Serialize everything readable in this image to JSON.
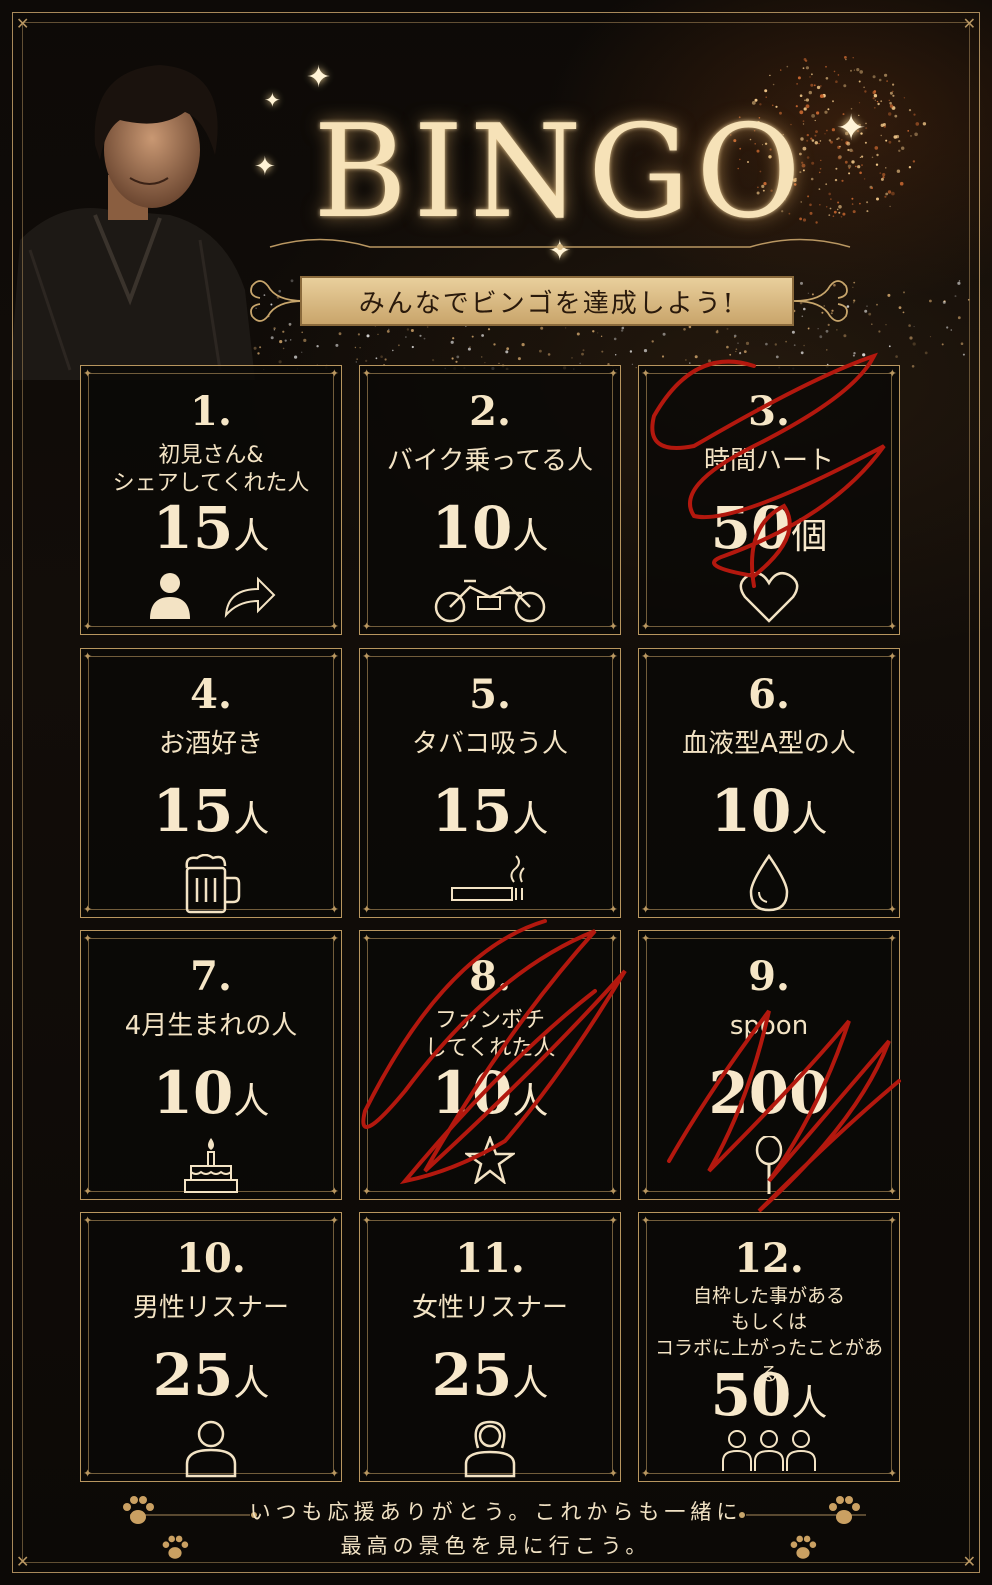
{
  "header": {
    "title": "BINGO",
    "subtitle": "みんなでビンゴを達成しよう!"
  },
  "cells": [
    {
      "number": "1.",
      "label_lines": [
        "初見さん&",
        "シェアしてくれた人"
      ],
      "goal": "15",
      "unit": "人",
      "icon": "user-share-icon",
      "crossed": false
    },
    {
      "number": "2.",
      "label_lines": [
        "バイク乗ってる人"
      ],
      "goal": "10",
      "unit": "人",
      "icon": "motorcycle-icon",
      "crossed": false
    },
    {
      "number": "3.",
      "label_lines": [
        "時間ハート"
      ],
      "goal": "50",
      "unit": "個",
      "icon": "heart-icon",
      "crossed": true
    },
    {
      "number": "4.",
      "label_lines": [
        "お酒好き"
      ],
      "goal": "15",
      "unit": "人",
      "icon": "beer-mug-icon",
      "crossed": false
    },
    {
      "number": "5.",
      "label_lines": [
        "タバコ吸う人"
      ],
      "goal": "15",
      "unit": "人",
      "icon": "cigarette-icon",
      "crossed": false
    },
    {
      "number": "6.",
      "label_lines": [
        "血液型A型の人"
      ],
      "goal": "10",
      "unit": "人",
      "icon": "blood-drop-icon",
      "crossed": false
    },
    {
      "number": "7.",
      "label_lines": [
        "4月生まれの人"
      ],
      "goal": "10",
      "unit": "人",
      "icon": "birthday-cake-icon",
      "crossed": false
    },
    {
      "number": "8.",
      "label_lines": [
        "ファンボチ",
        "してくれた人"
      ],
      "goal": "10",
      "unit": "人",
      "icon": "star-icon",
      "crossed": true
    },
    {
      "number": "9.",
      "label_lines": [
        "spoon"
      ],
      "goal": "200",
      "unit": "",
      "icon": "spoon-icon",
      "crossed": true
    },
    {
      "number": "10.",
      "label_lines": [
        "男性リスナー"
      ],
      "goal": "25",
      "unit": "人",
      "icon": "male-user-icon",
      "crossed": false
    },
    {
      "number": "11.",
      "label_lines": [
        "女性リスナー"
      ],
      "goal": "25",
      "unit": "人",
      "icon": "female-user-icon",
      "crossed": false
    },
    {
      "number": "12.",
      "label_lines": [
        "自枠した事がある",
        "もしくは",
        "コラボに上がったことがある"
      ],
      "goal": "50",
      "unit": "人",
      "icon": "group-users-icon",
      "crossed": false
    }
  ],
  "footer": {
    "line1": "いつも応援ありがとう。これからも一緒に",
    "line2": "最高の景色を見に行こう。"
  },
  "colors": {
    "gold": "#d9bb86",
    "scribble": "#b3180e",
    "banner": "#e2c792"
  }
}
